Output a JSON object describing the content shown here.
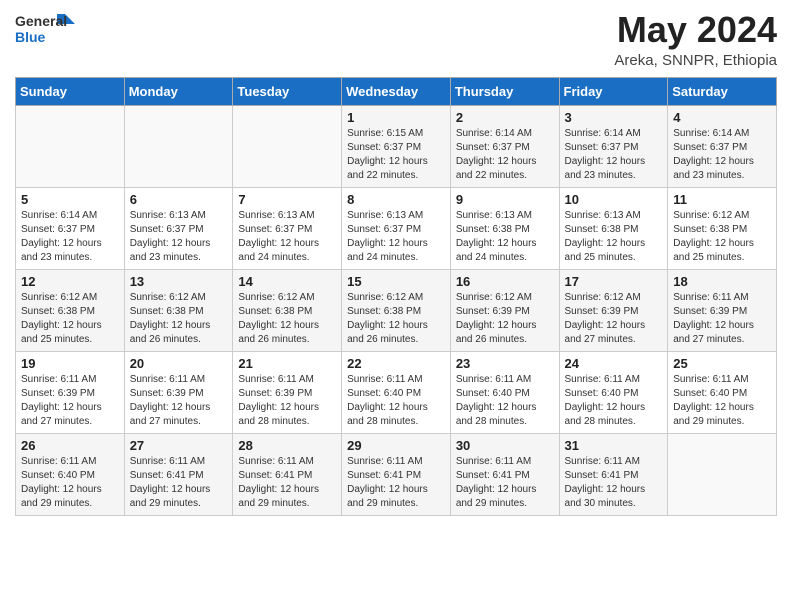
{
  "header": {
    "logo_general": "General",
    "logo_blue": "Blue",
    "title": "May 2024",
    "location": "Areka, SNNPR, Ethiopia"
  },
  "weekdays": [
    "Sunday",
    "Monday",
    "Tuesday",
    "Wednesday",
    "Thursday",
    "Friday",
    "Saturday"
  ],
  "weeks": [
    [
      {
        "day": "",
        "info": ""
      },
      {
        "day": "",
        "info": ""
      },
      {
        "day": "",
        "info": ""
      },
      {
        "day": "1",
        "info": "Sunrise: 6:15 AM\nSunset: 6:37 PM\nDaylight: 12 hours\nand 22 minutes."
      },
      {
        "day": "2",
        "info": "Sunrise: 6:14 AM\nSunset: 6:37 PM\nDaylight: 12 hours\nand 22 minutes."
      },
      {
        "day": "3",
        "info": "Sunrise: 6:14 AM\nSunset: 6:37 PM\nDaylight: 12 hours\nand 23 minutes."
      },
      {
        "day": "4",
        "info": "Sunrise: 6:14 AM\nSunset: 6:37 PM\nDaylight: 12 hours\nand 23 minutes."
      }
    ],
    [
      {
        "day": "5",
        "info": "Sunrise: 6:14 AM\nSunset: 6:37 PM\nDaylight: 12 hours\nand 23 minutes."
      },
      {
        "day": "6",
        "info": "Sunrise: 6:13 AM\nSunset: 6:37 PM\nDaylight: 12 hours\nand 23 minutes."
      },
      {
        "day": "7",
        "info": "Sunrise: 6:13 AM\nSunset: 6:37 PM\nDaylight: 12 hours\nand 24 minutes."
      },
      {
        "day": "8",
        "info": "Sunrise: 6:13 AM\nSunset: 6:37 PM\nDaylight: 12 hours\nand 24 minutes."
      },
      {
        "day": "9",
        "info": "Sunrise: 6:13 AM\nSunset: 6:38 PM\nDaylight: 12 hours\nand 24 minutes."
      },
      {
        "day": "10",
        "info": "Sunrise: 6:13 AM\nSunset: 6:38 PM\nDaylight: 12 hours\nand 25 minutes."
      },
      {
        "day": "11",
        "info": "Sunrise: 6:12 AM\nSunset: 6:38 PM\nDaylight: 12 hours\nand 25 minutes."
      }
    ],
    [
      {
        "day": "12",
        "info": "Sunrise: 6:12 AM\nSunset: 6:38 PM\nDaylight: 12 hours\nand 25 minutes."
      },
      {
        "day": "13",
        "info": "Sunrise: 6:12 AM\nSunset: 6:38 PM\nDaylight: 12 hours\nand 26 minutes."
      },
      {
        "day": "14",
        "info": "Sunrise: 6:12 AM\nSunset: 6:38 PM\nDaylight: 12 hours\nand 26 minutes."
      },
      {
        "day": "15",
        "info": "Sunrise: 6:12 AM\nSunset: 6:38 PM\nDaylight: 12 hours\nand 26 minutes."
      },
      {
        "day": "16",
        "info": "Sunrise: 6:12 AM\nSunset: 6:39 PM\nDaylight: 12 hours\nand 26 minutes."
      },
      {
        "day": "17",
        "info": "Sunrise: 6:12 AM\nSunset: 6:39 PM\nDaylight: 12 hours\nand 27 minutes."
      },
      {
        "day": "18",
        "info": "Sunrise: 6:11 AM\nSunset: 6:39 PM\nDaylight: 12 hours\nand 27 minutes."
      }
    ],
    [
      {
        "day": "19",
        "info": "Sunrise: 6:11 AM\nSunset: 6:39 PM\nDaylight: 12 hours\nand 27 minutes."
      },
      {
        "day": "20",
        "info": "Sunrise: 6:11 AM\nSunset: 6:39 PM\nDaylight: 12 hours\nand 27 minutes."
      },
      {
        "day": "21",
        "info": "Sunrise: 6:11 AM\nSunset: 6:39 PM\nDaylight: 12 hours\nand 28 minutes."
      },
      {
        "day": "22",
        "info": "Sunrise: 6:11 AM\nSunset: 6:40 PM\nDaylight: 12 hours\nand 28 minutes."
      },
      {
        "day": "23",
        "info": "Sunrise: 6:11 AM\nSunset: 6:40 PM\nDaylight: 12 hours\nand 28 minutes."
      },
      {
        "day": "24",
        "info": "Sunrise: 6:11 AM\nSunset: 6:40 PM\nDaylight: 12 hours\nand 28 minutes."
      },
      {
        "day": "25",
        "info": "Sunrise: 6:11 AM\nSunset: 6:40 PM\nDaylight: 12 hours\nand 29 minutes."
      }
    ],
    [
      {
        "day": "26",
        "info": "Sunrise: 6:11 AM\nSunset: 6:40 PM\nDaylight: 12 hours\nand 29 minutes."
      },
      {
        "day": "27",
        "info": "Sunrise: 6:11 AM\nSunset: 6:41 PM\nDaylight: 12 hours\nand 29 minutes."
      },
      {
        "day": "28",
        "info": "Sunrise: 6:11 AM\nSunset: 6:41 PM\nDaylight: 12 hours\nand 29 minutes."
      },
      {
        "day": "29",
        "info": "Sunrise: 6:11 AM\nSunset: 6:41 PM\nDaylight: 12 hours\nand 29 minutes."
      },
      {
        "day": "30",
        "info": "Sunrise: 6:11 AM\nSunset: 6:41 PM\nDaylight: 12 hours\nand 29 minutes."
      },
      {
        "day": "31",
        "info": "Sunrise: 6:11 AM\nSunset: 6:41 PM\nDaylight: 12 hours\nand 30 minutes."
      },
      {
        "day": "",
        "info": ""
      }
    ]
  ]
}
